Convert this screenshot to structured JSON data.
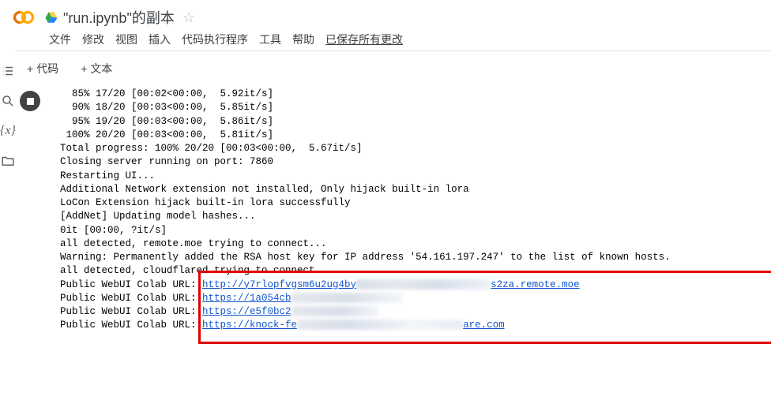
{
  "header": {
    "title": "\"run.ipynb\"的副本",
    "menus": [
      "文件",
      "修改",
      "视图",
      "插入",
      "代码执行程序",
      "工具",
      "帮助"
    ],
    "save_status": "已保存所有更改"
  },
  "toolbar": {
    "code": "代码",
    "text": "文本"
  },
  "output_lines": [
    "  85% 17/20 [00:02<00:00,  5.92it/s]",
    "  90% 18/20 [00:03<00:00,  5.85it/s]",
    "  95% 19/20 [00:03<00:00,  5.86it/s]",
    " 100% 20/20 [00:03<00:00,  5.81it/s]",
    "Total progress: 100% 20/20 [00:03<00:00,  5.67it/s]",
    "Closing server running on port: 7860",
    "Restarting UI...",
    "Additional Network extension not installed, Only hijack built-in lora",
    "LoCon Extension hijack built-in lora successfully",
    "[AddNet] Updating model hashes...",
    "0it [00:00, ?it/s]",
    "all detected, remote.moe trying to connect...",
    "Warning: Permanently added the RSA host key for IP address '54.161.197.247' to the list of known hosts.",
    "all detected, cloudflared trying to connect..."
  ],
  "url_lines": [
    {
      "prefix": "Public WebUI Colab URL: ",
      "link": "http://y7rlopfvgsm6u2ug4by",
      "tail_link": "s2za.remote.moe",
      "smudge": "smudge1"
    },
    {
      "prefix": "Public WebUI Colab URL: ",
      "link": "https://1a054cb",
      "tail_link": "",
      "smudge": "smudge2"
    },
    {
      "prefix": "Public WebUI Colab URL: ",
      "link": "https://e5f0bc2",
      "tail_link": "",
      "smudge": "smudge3"
    },
    {
      "prefix": "Public WebUI Colab URL: ",
      "link": "https://knock-fe",
      "tail_link": "are.com",
      "smudge": "smudge4"
    }
  ]
}
